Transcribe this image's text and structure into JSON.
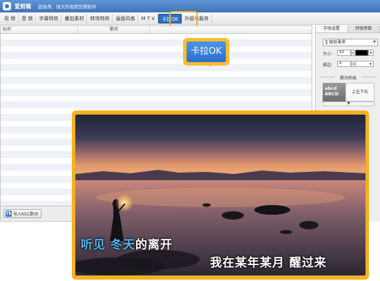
{
  "app": {
    "name": "爱剪辑",
    "slogan": "超易用、强大的视频剪辑软件"
  },
  "menu": {
    "items": [
      "视  频",
      "音  频",
      "字幕特效",
      "叠加素材",
      "转场特效",
      "画面风格",
      "M T V",
      "卡拉OK",
      "升级与服务"
    ],
    "active": "卡拉OK"
  },
  "table": {
    "headers": {
      "mark": "标识",
      "lyric": "歌词"
    }
  },
  "bottom": {
    "import_icon": "Tk",
    "import_label": "导入KSC歌词"
  },
  "right_panel": {
    "tabs": [
      "字体设置",
      "特效参数"
    ],
    "font_name": "微软雅黑",
    "size_label": "大小:",
    "size_value": "93",
    "color": "#000000",
    "stroke_label": "描边:",
    "stroke_value": "9",
    "layout_section": "歌词布局",
    "layout_preview_line1": "abcd",
    "layout_preview_line2": "ABCD",
    "layout_option": "上左下右"
  },
  "callout": {
    "label": "卡拉OK"
  },
  "preview": {
    "line1_sung": "听见 冬天",
    "line1_rest": "的离开",
    "line2": "我在某年某月 醒过来",
    "colors": {
      "sung": "#52b8f5",
      "unsung": "#ffffff",
      "frame": "#f5b11f"
    }
  }
}
